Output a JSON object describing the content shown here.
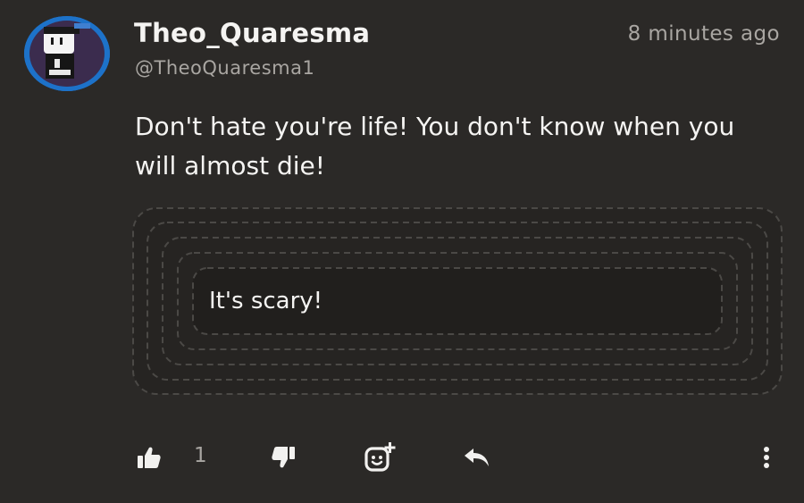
{
  "post": {
    "username": "Theo_Quaresma",
    "handle": "@TheoQuaresma1",
    "time": "8 minutes ago",
    "text": "Don't hate you're life! You don't know when you will almost die!",
    "quote": "It's scary!"
  },
  "actions": {
    "like_count": "1"
  },
  "icons": {
    "like": "thumbs-up-icon",
    "dislike": "thumbs-down-icon",
    "reaction": "add-reaction-icon",
    "reply": "reply-icon",
    "more": "more-vertical-icon"
  },
  "colors": {
    "background": "#2b2927",
    "text": "#f5f4f2",
    "muted": "#a9a6a2",
    "avatar_ring": "#1d72c9"
  }
}
